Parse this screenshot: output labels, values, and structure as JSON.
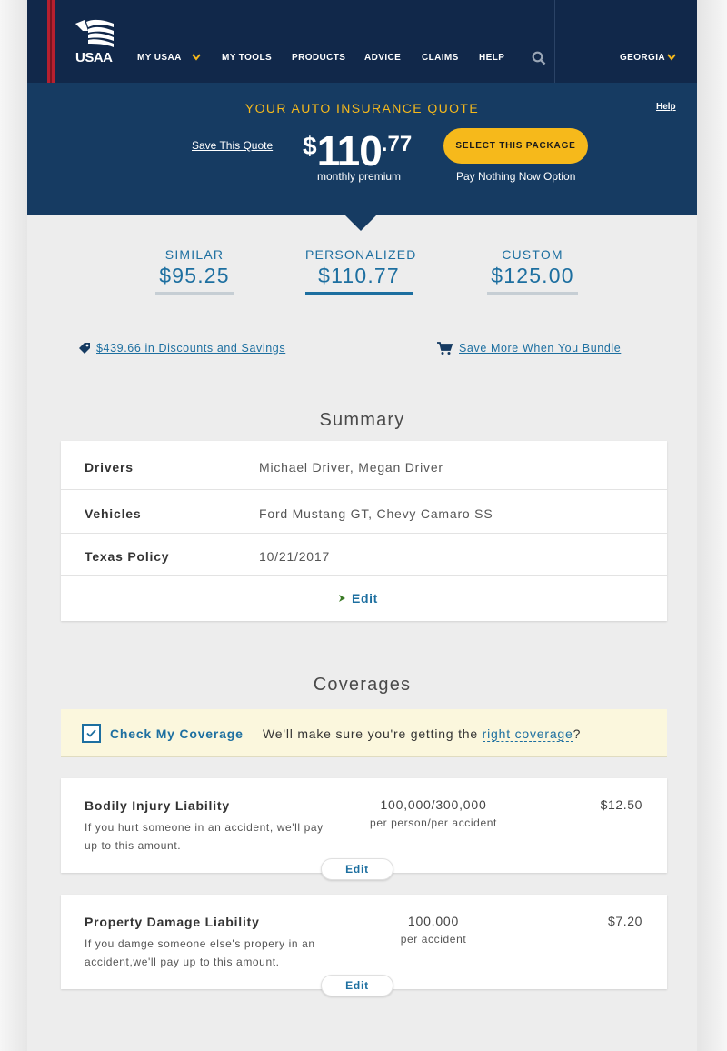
{
  "nav": {
    "logo_text": "USAA",
    "items": [
      "MY USAA",
      "MY TOOLS",
      "PRODUCTS",
      "ADVICE",
      "CLAIMS",
      "HELP"
    ],
    "region": "GEORGIA"
  },
  "banner": {
    "title": "YOUR AUTO INSURANCE QUOTE",
    "help": "Help",
    "save_quote": "Save This Quote",
    "price_dollar": "$",
    "price_main": "110",
    "price_cents": ".77",
    "price_caption": "monthly premium",
    "select_button": "SELECT THIS PACKAGE",
    "pay_option": "Pay Nothing Now Option"
  },
  "packages": [
    {
      "label": "SIMILAR",
      "amount": "$95.25"
    },
    {
      "label": "PERSONALIZED",
      "amount": "$110.77"
    },
    {
      "label": "CUSTOM",
      "amount": "$125.00"
    }
  ],
  "links": {
    "discounts": "$439.66 in Discounts and Savings",
    "bundle": "Save More When You Bundle"
  },
  "summary": {
    "title": "Summary",
    "rows": [
      {
        "key": "Drivers",
        "value": "Michael Driver, Megan Driver"
      },
      {
        "key": "Vehicles",
        "value": "Ford Mustang GT, Chevy Camaro SS"
      },
      {
        "key": "Texas Policy",
        "value": "10/21/2017"
      }
    ],
    "edit": "Edit"
  },
  "coverages": {
    "title": "Coverages",
    "check_label": "Check My Coverage",
    "check_text": "We'll make sure you're getting the",
    "check_link": "right coverage",
    "check_end": "?",
    "items": [
      {
        "name": "Bodily Injury Liability",
        "desc": "If you hurt someone in an accident, we'll pay up to this amount.",
        "limit": "100,000/300,000",
        "limit_sub": "per person/per accident",
        "price": "$12.50",
        "edit": "Edit"
      },
      {
        "name": "Property Damage Liability",
        "desc": "If you damge someone else's propery in an accident,we'll pay up to this amount.",
        "limit": "100,000",
        "limit_sub": "per accident",
        "price": "$7.20",
        "edit": "Edit"
      }
    ]
  },
  "colors": {
    "nav_bg": "#11284a",
    "banner_bg": "#163b62",
    "accent_yellow": "#f6b91b",
    "link_blue": "#1d6fa0",
    "brand_red": "#b6202f"
  }
}
